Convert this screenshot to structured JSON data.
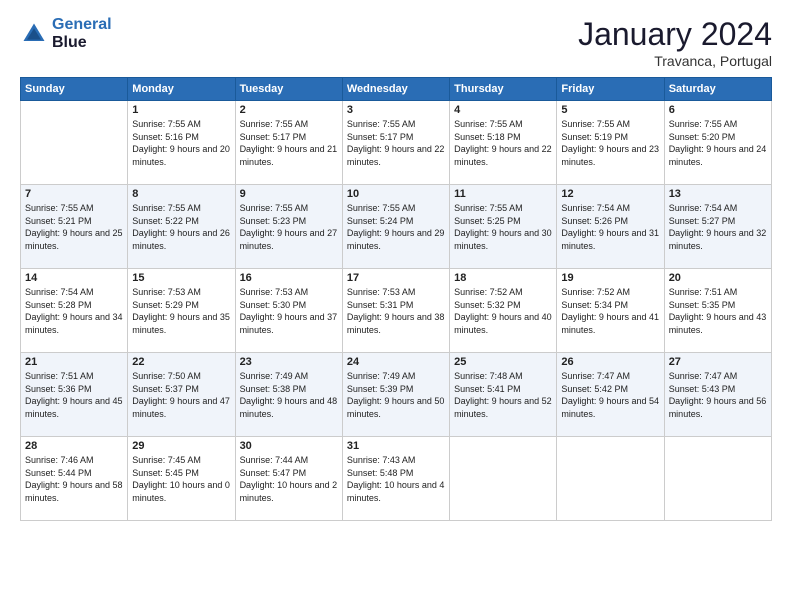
{
  "logo": {
    "line1": "General",
    "line2": "Blue"
  },
  "title": "January 2024",
  "subtitle": "Travanca, Portugal",
  "days_header": [
    "Sunday",
    "Monday",
    "Tuesday",
    "Wednesday",
    "Thursday",
    "Friday",
    "Saturday"
  ],
  "weeks": [
    [
      {
        "day": "",
        "sunrise": "",
        "sunset": "",
        "daylight": ""
      },
      {
        "day": "1",
        "sunrise": "Sunrise: 7:55 AM",
        "sunset": "Sunset: 5:16 PM",
        "daylight": "Daylight: 9 hours and 20 minutes."
      },
      {
        "day": "2",
        "sunrise": "Sunrise: 7:55 AM",
        "sunset": "Sunset: 5:17 PM",
        "daylight": "Daylight: 9 hours and 21 minutes."
      },
      {
        "day": "3",
        "sunrise": "Sunrise: 7:55 AM",
        "sunset": "Sunset: 5:17 PM",
        "daylight": "Daylight: 9 hours and 22 minutes."
      },
      {
        "day": "4",
        "sunrise": "Sunrise: 7:55 AM",
        "sunset": "Sunset: 5:18 PM",
        "daylight": "Daylight: 9 hours and 22 minutes."
      },
      {
        "day": "5",
        "sunrise": "Sunrise: 7:55 AM",
        "sunset": "Sunset: 5:19 PM",
        "daylight": "Daylight: 9 hours and 23 minutes."
      },
      {
        "day": "6",
        "sunrise": "Sunrise: 7:55 AM",
        "sunset": "Sunset: 5:20 PM",
        "daylight": "Daylight: 9 hours and 24 minutes."
      }
    ],
    [
      {
        "day": "7",
        "sunrise": "Sunrise: 7:55 AM",
        "sunset": "Sunset: 5:21 PM",
        "daylight": "Daylight: 9 hours and 25 minutes."
      },
      {
        "day": "8",
        "sunrise": "Sunrise: 7:55 AM",
        "sunset": "Sunset: 5:22 PM",
        "daylight": "Daylight: 9 hours and 26 minutes."
      },
      {
        "day": "9",
        "sunrise": "Sunrise: 7:55 AM",
        "sunset": "Sunset: 5:23 PM",
        "daylight": "Daylight: 9 hours and 27 minutes."
      },
      {
        "day": "10",
        "sunrise": "Sunrise: 7:55 AM",
        "sunset": "Sunset: 5:24 PM",
        "daylight": "Daylight: 9 hours and 29 minutes."
      },
      {
        "day": "11",
        "sunrise": "Sunrise: 7:55 AM",
        "sunset": "Sunset: 5:25 PM",
        "daylight": "Daylight: 9 hours and 30 minutes."
      },
      {
        "day": "12",
        "sunrise": "Sunrise: 7:54 AM",
        "sunset": "Sunset: 5:26 PM",
        "daylight": "Daylight: 9 hours and 31 minutes."
      },
      {
        "day": "13",
        "sunrise": "Sunrise: 7:54 AM",
        "sunset": "Sunset: 5:27 PM",
        "daylight": "Daylight: 9 hours and 32 minutes."
      }
    ],
    [
      {
        "day": "14",
        "sunrise": "Sunrise: 7:54 AM",
        "sunset": "Sunset: 5:28 PM",
        "daylight": "Daylight: 9 hours and 34 minutes."
      },
      {
        "day": "15",
        "sunrise": "Sunrise: 7:53 AM",
        "sunset": "Sunset: 5:29 PM",
        "daylight": "Daylight: 9 hours and 35 minutes."
      },
      {
        "day": "16",
        "sunrise": "Sunrise: 7:53 AM",
        "sunset": "Sunset: 5:30 PM",
        "daylight": "Daylight: 9 hours and 37 minutes."
      },
      {
        "day": "17",
        "sunrise": "Sunrise: 7:53 AM",
        "sunset": "Sunset: 5:31 PM",
        "daylight": "Daylight: 9 hours and 38 minutes."
      },
      {
        "day": "18",
        "sunrise": "Sunrise: 7:52 AM",
        "sunset": "Sunset: 5:32 PM",
        "daylight": "Daylight: 9 hours and 40 minutes."
      },
      {
        "day": "19",
        "sunrise": "Sunrise: 7:52 AM",
        "sunset": "Sunset: 5:34 PM",
        "daylight": "Daylight: 9 hours and 41 minutes."
      },
      {
        "day": "20",
        "sunrise": "Sunrise: 7:51 AM",
        "sunset": "Sunset: 5:35 PM",
        "daylight": "Daylight: 9 hours and 43 minutes."
      }
    ],
    [
      {
        "day": "21",
        "sunrise": "Sunrise: 7:51 AM",
        "sunset": "Sunset: 5:36 PM",
        "daylight": "Daylight: 9 hours and 45 minutes."
      },
      {
        "day": "22",
        "sunrise": "Sunrise: 7:50 AM",
        "sunset": "Sunset: 5:37 PM",
        "daylight": "Daylight: 9 hours and 47 minutes."
      },
      {
        "day": "23",
        "sunrise": "Sunrise: 7:49 AM",
        "sunset": "Sunset: 5:38 PM",
        "daylight": "Daylight: 9 hours and 48 minutes."
      },
      {
        "day": "24",
        "sunrise": "Sunrise: 7:49 AM",
        "sunset": "Sunset: 5:39 PM",
        "daylight": "Daylight: 9 hours and 50 minutes."
      },
      {
        "day": "25",
        "sunrise": "Sunrise: 7:48 AM",
        "sunset": "Sunset: 5:41 PM",
        "daylight": "Daylight: 9 hours and 52 minutes."
      },
      {
        "day": "26",
        "sunrise": "Sunrise: 7:47 AM",
        "sunset": "Sunset: 5:42 PM",
        "daylight": "Daylight: 9 hours and 54 minutes."
      },
      {
        "day": "27",
        "sunrise": "Sunrise: 7:47 AM",
        "sunset": "Sunset: 5:43 PM",
        "daylight": "Daylight: 9 hours and 56 minutes."
      }
    ],
    [
      {
        "day": "28",
        "sunrise": "Sunrise: 7:46 AM",
        "sunset": "Sunset: 5:44 PM",
        "daylight": "Daylight: 9 hours and 58 minutes."
      },
      {
        "day": "29",
        "sunrise": "Sunrise: 7:45 AM",
        "sunset": "Sunset: 5:45 PM",
        "daylight": "Daylight: 10 hours and 0 minutes."
      },
      {
        "day": "30",
        "sunrise": "Sunrise: 7:44 AM",
        "sunset": "Sunset: 5:47 PM",
        "daylight": "Daylight: 10 hours and 2 minutes."
      },
      {
        "day": "31",
        "sunrise": "Sunrise: 7:43 AM",
        "sunset": "Sunset: 5:48 PM",
        "daylight": "Daylight: 10 hours and 4 minutes."
      },
      {
        "day": "",
        "sunrise": "",
        "sunset": "",
        "daylight": ""
      },
      {
        "day": "",
        "sunrise": "",
        "sunset": "",
        "daylight": ""
      },
      {
        "day": "",
        "sunrise": "",
        "sunset": "",
        "daylight": ""
      }
    ]
  ]
}
